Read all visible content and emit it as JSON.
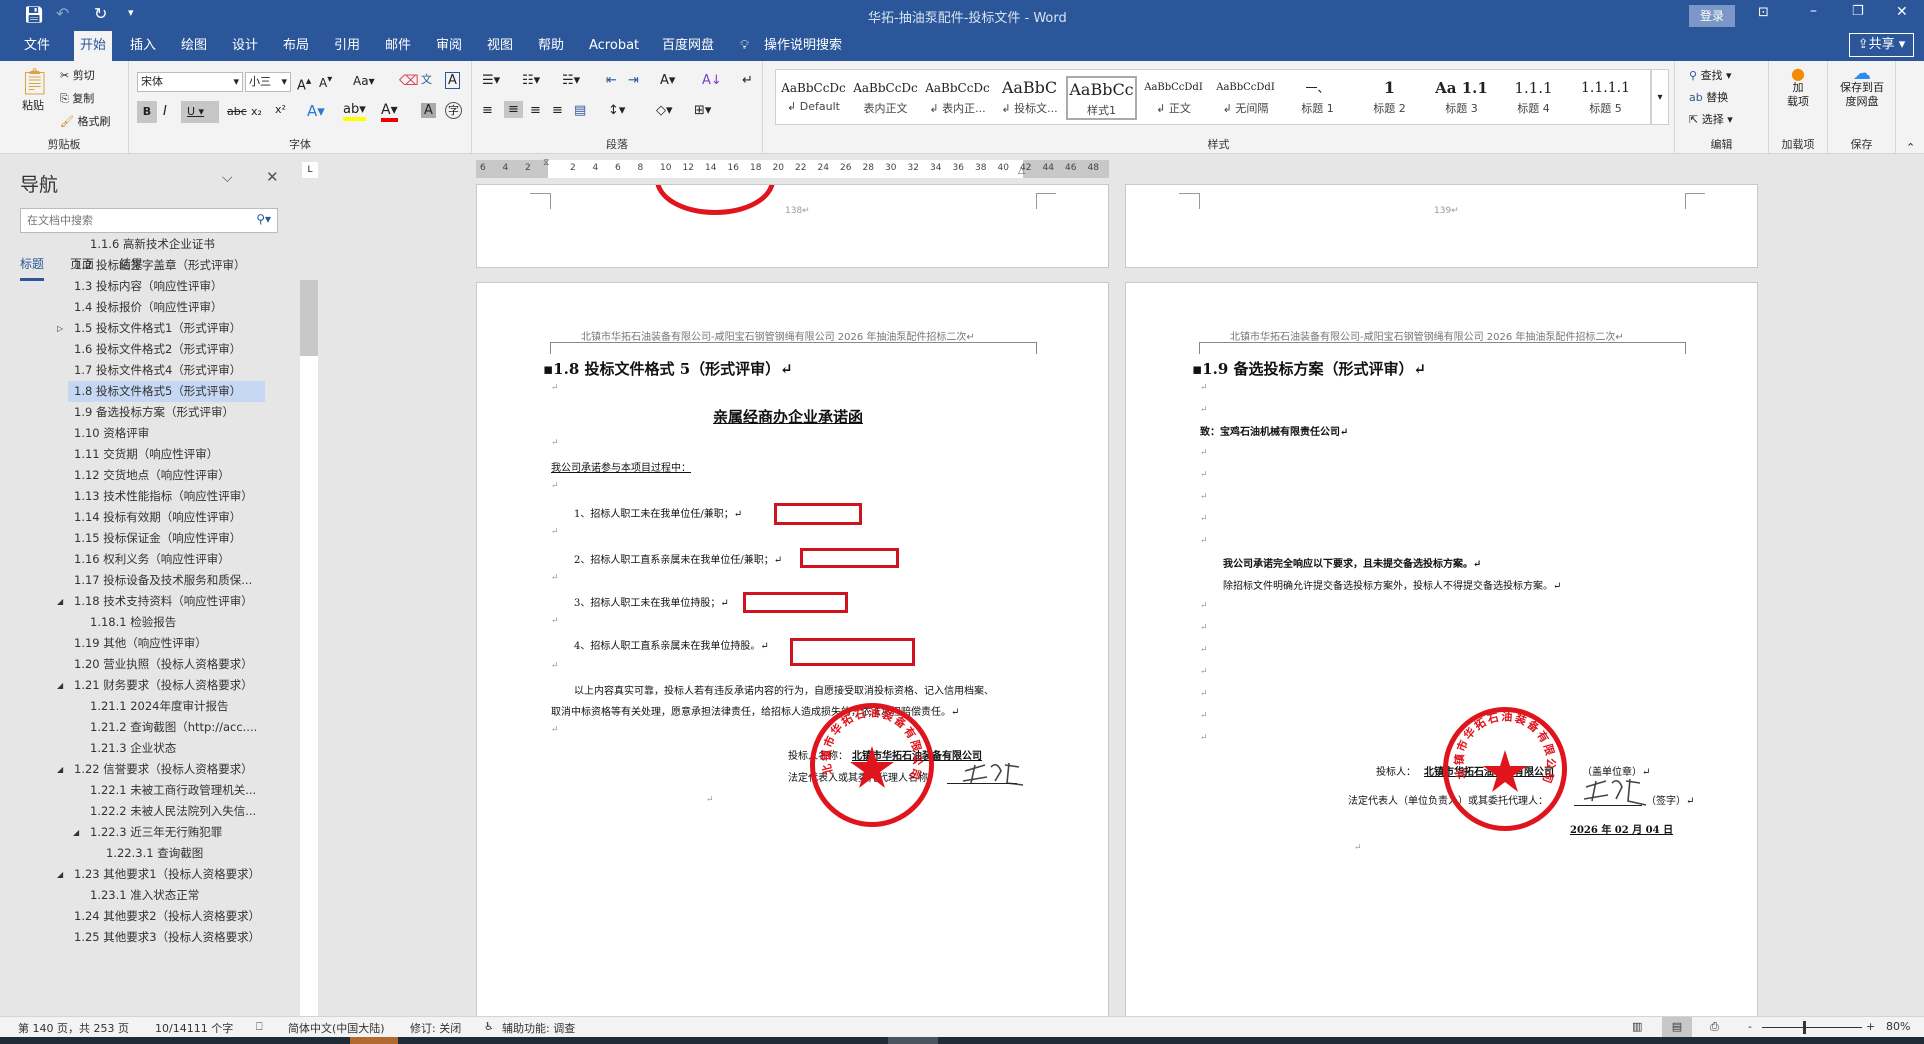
{
  "window": {
    "title": "华拓-抽油泵配件-投标文件  -  Word",
    "login": "登录",
    "share": "共享"
  },
  "quick_access": {
    "save_icon": "save-icon",
    "undo_icon": "undo-icon",
    "redo_icon": "redo-icon"
  },
  "tabs": [
    "文件",
    "开始",
    "插入",
    "绘图",
    "设计",
    "布局",
    "引用",
    "邮件",
    "审阅",
    "视图",
    "帮助",
    "Acrobat",
    "百度网盘"
  ],
  "tell_me": "操作说明搜索",
  "ribbon": {
    "clipboard": {
      "label": "剪贴板",
      "paste": "粘贴",
      "cut": "剪切",
      "copy": "复制",
      "format_painter": "格式刷"
    },
    "font": {
      "label": "字体",
      "font_name": "宋体",
      "font_size": "小三",
      "case": "Aa",
      "bold": "B",
      "italic": "I",
      "underline": "U",
      "strike": "abc",
      "sub": "x₂",
      "sup": "x²"
    },
    "paragraph": {
      "label": "段落"
    },
    "styles": {
      "label": "样式",
      "items": [
        {
          "preview": "AaBbCcDc",
          "name": "↲ Default"
        },
        {
          "preview": "AaBbCcDc",
          "name": "表内正文"
        },
        {
          "preview": "AaBbCcDc",
          "name": "↲ 表内正..."
        },
        {
          "preview": "AaBbC",
          "name": "↲ 投标文..."
        },
        {
          "preview": "AaBbCc",
          "name": "样式1"
        },
        {
          "preview": "AaBbCcDdI",
          "name": "↲ 正文"
        },
        {
          "preview": "AaBbCcDdI",
          "name": "↲ 无间隔"
        },
        {
          "preview": "一、",
          "name": "标题 1"
        },
        {
          "preview": "1",
          "name": "标题 2"
        },
        {
          "preview": "Aa  1.1",
          "name": "标题 3"
        },
        {
          "preview": "1.1.1",
          "name": "标题 4"
        },
        {
          "preview": "1.1.1.1",
          "name": "标题 5"
        }
      ],
      "selected": "样式1"
    },
    "editing": {
      "label": "编辑",
      "find": "查找",
      "replace": "替换",
      "select": "选择"
    },
    "addins": {
      "label": "加载项",
      "button": "加\n载项"
    },
    "save": {
      "label": "保存",
      "button": "保存到百度网盘"
    }
  },
  "nav": {
    "title": "导航",
    "search_placeholder": "在文档中搜索",
    "tabs": [
      "标题",
      "页面",
      "结果"
    ],
    "active_tab": "标题",
    "items": [
      {
        "text": "1.1.6 高新技术企业证书",
        "level": 3
      },
      {
        "text": "1.2 投标函签字盖章（形式评审）",
        "level": 2
      },
      {
        "text": "1.3 投标内容（响应性评审）",
        "level": 2
      },
      {
        "text": "1.4 投标报价（响应性评审）",
        "level": 2
      },
      {
        "text": "1.5 投标文件格式1（形式评审）",
        "level": 2,
        "toggle": "collapsed"
      },
      {
        "text": "1.6 投标文件格式2（形式评审）",
        "level": 2
      },
      {
        "text": "1.7 投标文件格式4（形式评审）",
        "level": 2
      },
      {
        "text": "1.8 投标文件格式5（形式评审）",
        "level": 2,
        "selected": true
      },
      {
        "text": "1.9 备选投标方案（形式评审）",
        "level": 2
      },
      {
        "text": "1.10 资格评审",
        "level": 2
      },
      {
        "text": "1.11 交货期（响应性评审）",
        "level": 2
      },
      {
        "text": "1.12 交货地点（响应性评审）",
        "level": 2
      },
      {
        "text": "1.13  技术性能指标（响应性评审）",
        "level": 2
      },
      {
        "text": "1.14 投标有效期（响应性评审）",
        "level": 2
      },
      {
        "text": "1.15 投标保证金（响应性评审）",
        "level": 2
      },
      {
        "text": "1.16 权利义务（响应性评审）",
        "level": 2
      },
      {
        "text": "1.17 投标设备及技术服务和质保...",
        "level": 2
      },
      {
        "text": "1.18 技术支持资料（响应性评审）",
        "level": 2,
        "toggle": "expanded"
      },
      {
        "text": "1.18.1 检验报告",
        "level": 3
      },
      {
        "text": "1.19 其他（响应性评审）",
        "level": 2
      },
      {
        "text": "1.20 营业执照（投标人资格要求）",
        "level": 2
      },
      {
        "text": "1.21 财务要求（投标人资格要求）",
        "level": 2,
        "toggle": "expanded"
      },
      {
        "text": "1.21.1 2024年度审计报告",
        "level": 3
      },
      {
        "text": "1.21.2 查询截图（http://acc....",
        "level": 3
      },
      {
        "text": "1.21.3 企业状态",
        "level": 3
      },
      {
        "text": "1.22 信誉要求（投标人资格要求）",
        "level": 2,
        "toggle": "expanded"
      },
      {
        "text": "1.22.1 未被工商行政管理机关...",
        "level": 3
      },
      {
        "text": "1.22.2 未被人民法院列入失信...",
        "level": 3
      },
      {
        "text": "1.22.3 近三年无行贿犯罪",
        "level": 3,
        "toggle": "expanded"
      },
      {
        "text": "1.22.3.1 查询截图",
        "level": 4
      },
      {
        "text": "1.23 其他要求1（投标人资格要求）",
        "level": 2,
        "toggle": "expanded"
      },
      {
        "text": "1.23.1 准入状态正常",
        "level": 3
      },
      {
        "text": "1.24 其他要求2（投标人资格要求）",
        "level": 2
      },
      {
        "text": "1.25 其他要求3（投标人资格要求）",
        "level": 2
      }
    ]
  },
  "ruler": [
    "6",
    "4",
    "2",
    "",
    "2",
    "4",
    "6",
    "8",
    "10",
    "12",
    "14",
    "16",
    "18",
    "20",
    "22",
    "24",
    "26",
    "28",
    "30",
    "32",
    "34",
    "36",
    "38",
    "40",
    "42",
    "44",
    "46",
    "48"
  ],
  "pages": {
    "top_left_number": "138↵",
    "top_right_number": "139↵",
    "header": "北镇市华拓石油装备有限公司-咸阳宝石钢管钢绳有限公司 2026 年抽油泵配件招标二次↵",
    "left": {
      "heading": "▪1.8 投标文件格式 5（形式评审）↵",
      "title": "亲属经商办企业承诺函",
      "intro": "我公司承诺参与本项目过程中：",
      "items": [
        "1、招标人职工未在我单位任/兼职；↵",
        "2、招标人职工直系亲属未在我单位任/兼职；↵",
        "3、招标人职工未在我单位持股；↵",
        "4、招标人职工直系亲属未在我单位持股。↵"
      ],
      "para1": "以上内容真实可靠，投标人若有违反承诺内容的行为，自愿接受取消投标资格、记入信用档案、",
      "para2": "取消中标资格等有关处理，愿意承担法律责任，给招标人造成损失的，依法承担赔偿责任。↵",
      "bidder_label": "投标人名称：",
      "bidder_value": "北镇市华拓石油装备有限公司",
      "rep_label": "法定代表人或其委托代理人名称：",
      "seal_text": "北镇市华拓石油装备有限公司"
    },
    "right": {
      "heading": "▪1.9 备选投标方案（形式评审）↵",
      "to": "致：宝鸡石油机械有限责任公司↵",
      "commit": "我公司承诺完全响应以下要求，且未提交备选投标方案。↵",
      "note": "除招标文件明确允许提交备选投标方案外，投标人不得提交备选投标方案。↵",
      "bidder_label": "投标人：",
      "bidder_value": "北镇市华拓石油装备有限公司",
      "bidder_suffix": "（盖单位章）↵",
      "rep_label": "法定代表人（单位负责人）或其委托代理人：",
      "rep_suffix": "（签字）↵",
      "date": "2026 年 02 月 04 日",
      "seal_text": "北镇市华拓石油装备有限公司"
    }
  },
  "status": {
    "page": "第 140 页，共 253 页",
    "words": "10/14111 个字",
    "language": "简体中文(中国大陆)",
    "track": "修订: 关闭",
    "accessibility": "辅助功能: 调查",
    "zoom": "80%",
    "zoom_percent": 80
  },
  "colors": {
    "brand": "#2b579a",
    "seal": "#e0141c",
    "redbox": "#d0141f",
    "selection": "#c5d7f3"
  }
}
